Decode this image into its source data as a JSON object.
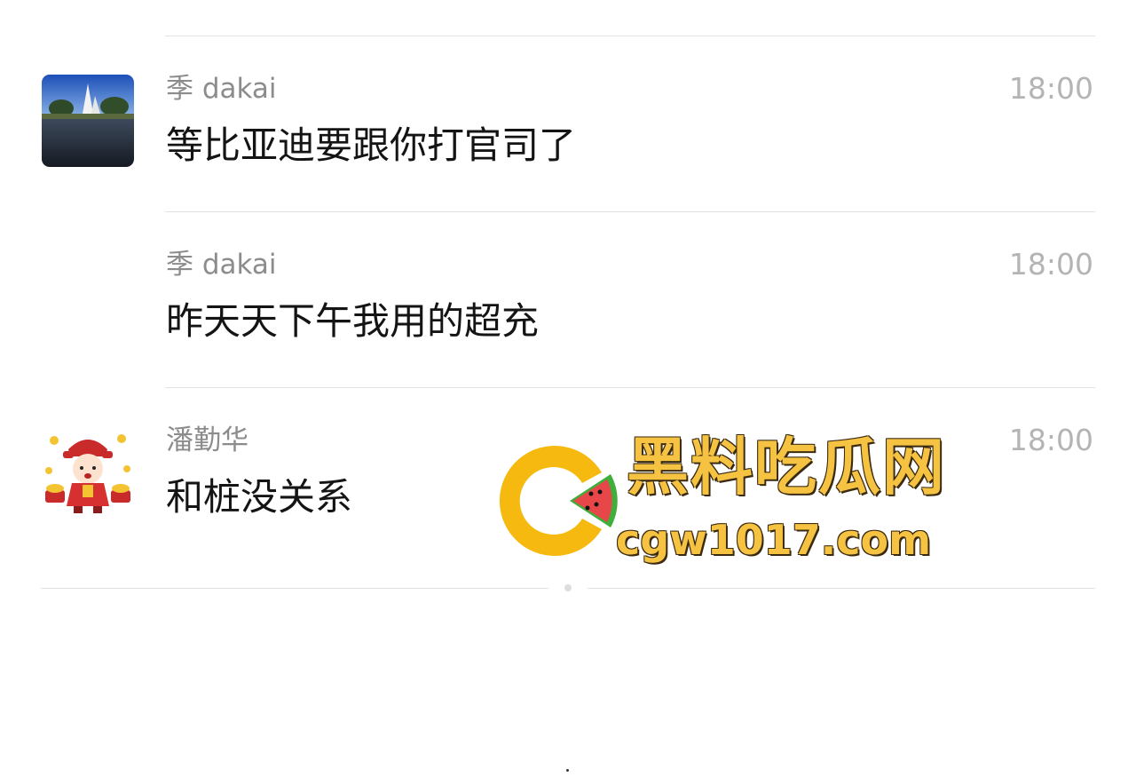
{
  "messages": [
    {
      "sender": "季 dakai",
      "time": "18:00",
      "text": "等比亚迪要跟你打官司了",
      "avatar": "landscape-photo-avatar"
    },
    {
      "sender": "季 dakai",
      "time": "18:00",
      "text": "昨天天下午我用的超充",
      "avatar": ""
    },
    {
      "sender": "潘勤华",
      "time": "18:00",
      "text": "和桩没关系",
      "avatar": "cartoon-fortune-god-avatar"
    }
  ],
  "watermark": {
    "title": "黑料吃瓜网",
    "url": "cgw1017.com",
    "brand_color": "#f5c242",
    "melon_color": "#e8474a"
  },
  "colors": {
    "sender": "#8c8c8c",
    "time": "#b4b4b4",
    "text": "#141414",
    "divider": "#e3e3e3"
  }
}
